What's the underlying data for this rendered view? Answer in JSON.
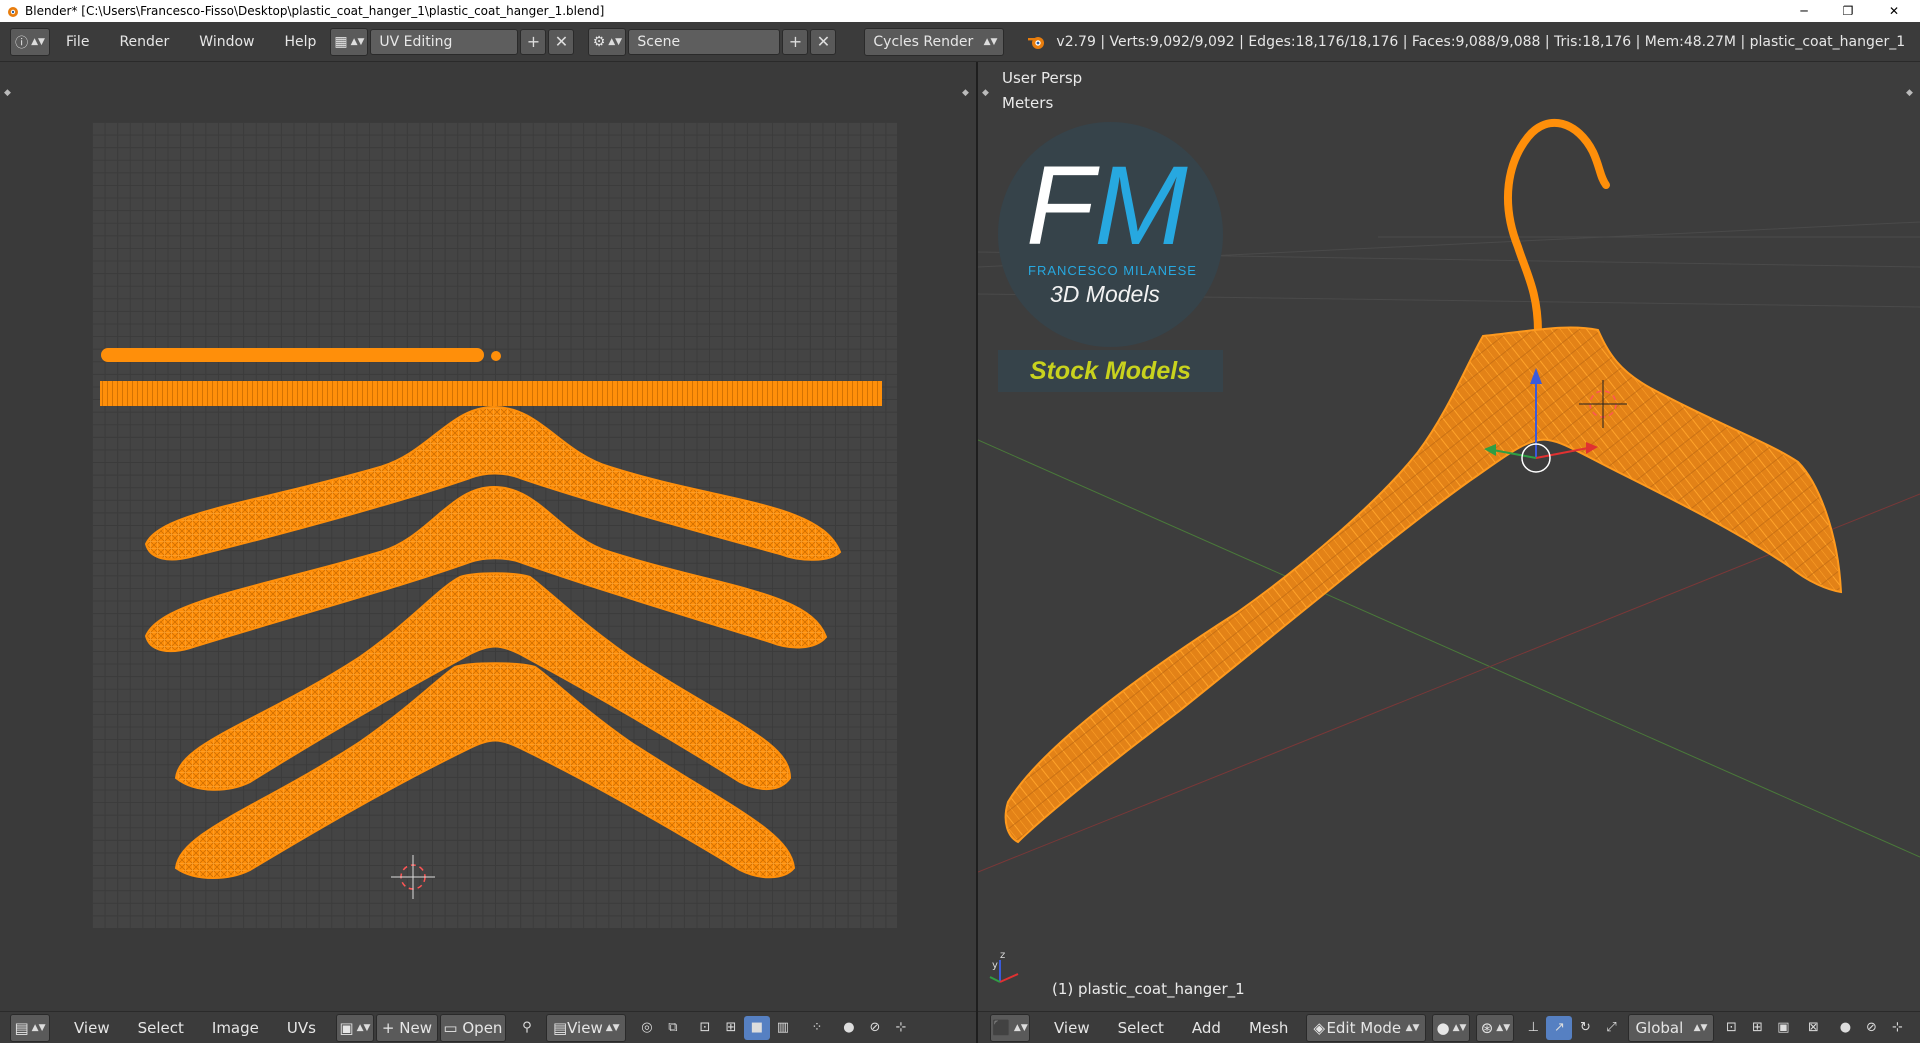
{
  "window": {
    "title": "Blender* [C:\\Users\\Francesco-Fisso\\Desktop\\plastic_coat_hanger_1\\plastic_coat_hanger_1.blend]",
    "minimize": "─",
    "restore": "❐",
    "close": "✕"
  },
  "info_header": {
    "menus": [
      "File",
      "Render",
      "Window",
      "Help"
    ],
    "screen_layout": "UV Editing",
    "scene": "Scene",
    "render_engine": "Cycles Render",
    "stats": "v2.79 | Verts:9,092/9,092 | Edges:18,176/18,176 | Faces:9,088/9,088 | Tris:18,176 | Mem:48.27M | plastic_coat_hanger_1"
  },
  "viewport": {
    "view_name": "User Persp",
    "units": "Meters",
    "object_label": "(1) plastic_coat_hanger_1",
    "logo": {
      "monogram_f": "F",
      "monogram_m": "M",
      "brand": "FRANCESCO MILANESE",
      "subtitle": "3D Models",
      "badge": "Stock Models"
    }
  },
  "uv_header": {
    "menus": [
      "View",
      "Select",
      "Image",
      "UVs"
    ],
    "new_label": "New",
    "open_label": "Open",
    "view_label": "View"
  },
  "view3d_header": {
    "menus": [
      "View",
      "Select",
      "Add",
      "Mesh"
    ],
    "mode": "Edit Mode",
    "orientation": "Global"
  },
  "colors": {
    "accent": "#ff8c00",
    "mesh_orange": "#ff8f0a",
    "logo_blue": "#27a8e0",
    "badge_text": "#c8d21e"
  }
}
